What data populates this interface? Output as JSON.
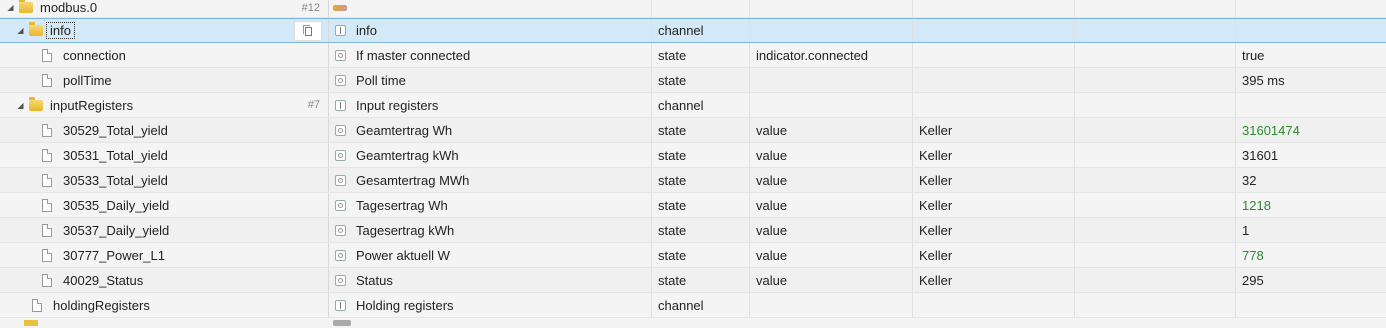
{
  "rows": [
    {
      "id": "modbus.0",
      "name": "",
      "type": "",
      "role": "",
      "room": "",
      "func": "",
      "value": "",
      "count": "#12"
    },
    {
      "id": "info",
      "name": "info",
      "type": "channel",
      "role": "",
      "room": "",
      "func": "",
      "value": ""
    },
    {
      "id": "connection",
      "name": "If master connected",
      "type": "state",
      "role": "indicator.connected",
      "room": "",
      "func": "",
      "value": "true"
    },
    {
      "id": "pollTime",
      "name": "Poll time",
      "type": "state",
      "role": "",
      "room": "",
      "func": "",
      "value": "395 ms"
    },
    {
      "id": "inputRegisters",
      "name": "Input registers",
      "type": "channel",
      "role": "",
      "room": "",
      "func": "",
      "value": "",
      "count": "#7"
    },
    {
      "id": "30529_Total_yield",
      "name": "Geamtertrag Wh",
      "type": "state",
      "role": "value",
      "room": "Keller",
      "func": "",
      "value": "31601474"
    },
    {
      "id": "30531_Total_yield",
      "name": "Geamtertrag kWh",
      "type": "state",
      "role": "value",
      "room": "Keller",
      "func": "",
      "value": "31601"
    },
    {
      "id": "30533_Total_yield",
      "name": "Gesamtertrag MWh",
      "type": "state",
      "role": "value",
      "room": "Keller",
      "func": "",
      "value": "32"
    },
    {
      "id": "30535_Daily_yield",
      "name": "Tagesertrag Wh",
      "type": "state",
      "role": "value",
      "room": "Keller",
      "func": "",
      "value": "1218"
    },
    {
      "id": "30537_Daily_yield",
      "name": "Tagesertrag kWh",
      "type": "state",
      "role": "value",
      "room": "Keller",
      "func": "",
      "value": "1"
    },
    {
      "id": "30777_Power_L1",
      "name": "Power aktuell W",
      "type": "state",
      "role": "value",
      "room": "Keller",
      "func": "",
      "value": "778"
    },
    {
      "id": "40029_Status",
      "name": "Status",
      "type": "state",
      "role": "value",
      "room": "Keller",
      "func": "",
      "value": "295"
    },
    {
      "id": "holdingRegisters",
      "name": "Holding registers",
      "type": "channel",
      "role": "",
      "room": "",
      "func": "",
      "value": ""
    }
  ],
  "colors": {
    "value_changed": "#2e8b2e",
    "selected_row": "#d4e9f7"
  },
  "icons": {
    "folder": "folder-icon",
    "file": "file-icon",
    "copy": "copy-icon",
    "state": "state-icon",
    "channel": "channel-icon"
  }
}
